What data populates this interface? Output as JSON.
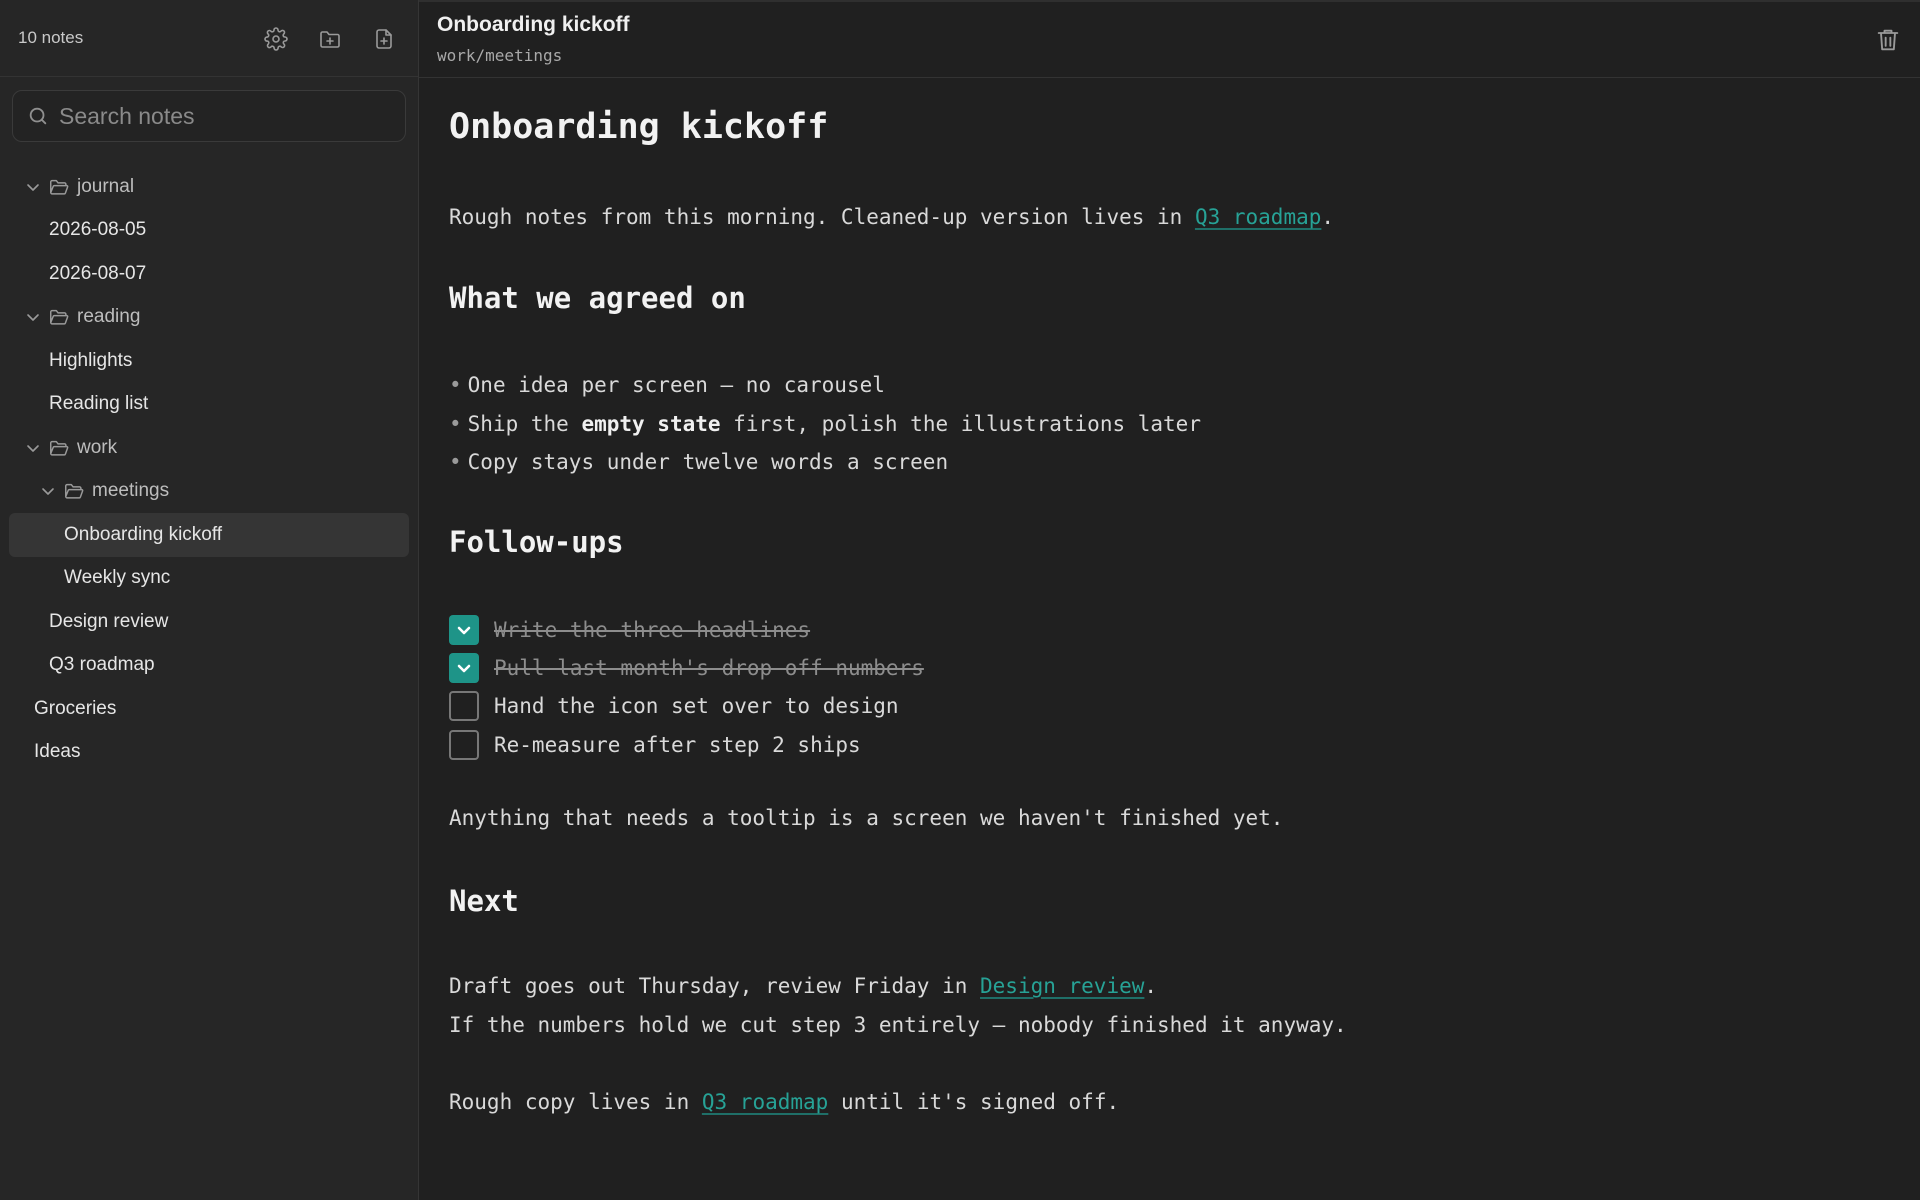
{
  "sidebar": {
    "note_count": "10 notes",
    "actions": [
      "settings",
      "new-folder",
      "new-note"
    ],
    "search": {
      "placeholder": "Search notes",
      "value": ""
    },
    "tree": [
      {
        "type": "folder",
        "label": "journal",
        "depth": 0,
        "expanded": true
      },
      {
        "type": "note",
        "label": "2026-08-05",
        "depth": 1
      },
      {
        "type": "note",
        "label": "2026-08-07",
        "depth": 1
      },
      {
        "type": "folder",
        "label": "reading",
        "depth": 0,
        "expanded": true
      },
      {
        "type": "note",
        "label": "Highlights",
        "depth": 1
      },
      {
        "type": "note",
        "label": "Reading list",
        "depth": 1
      },
      {
        "type": "folder",
        "label": "work",
        "depth": 0,
        "expanded": true
      },
      {
        "type": "folder",
        "label": "meetings",
        "depth": 1,
        "expanded": true
      },
      {
        "type": "note",
        "label": "Onboarding kickoff",
        "depth": 2,
        "active": true
      },
      {
        "type": "note",
        "label": "Weekly sync",
        "depth": 2
      },
      {
        "type": "note",
        "label": "Design review",
        "depth": 1
      },
      {
        "type": "note",
        "label": "Q3 roadmap",
        "depth": 1
      },
      {
        "type": "note",
        "label": "Groceries",
        "depth": 0
      },
      {
        "type": "note",
        "label": "Ideas",
        "depth": 0
      }
    ]
  },
  "note": {
    "title": "Onboarding kickoff",
    "path": "work/meetings",
    "heading": "Onboarding kickoff",
    "intro": {
      "before": "Rough notes from this morning. Cleaned-up version lives in ",
      "link": "Q3 roadmap",
      "after": "."
    },
    "section1": {
      "heading": "What we agreed on",
      "bullet1": "One idea per screen — no carousel",
      "bullet2_before": "Ship the ",
      "bullet2_bold": "empty state",
      "bullet2_after": " first, polish the illustrations later",
      "bullet3": "Copy stays under twelve words a screen"
    },
    "section2": {
      "heading": "Follow-ups",
      "tasks": [
        {
          "label": "Write the three headlines",
          "done": true
        },
        {
          "label": "Pull last month's drop-off numbers",
          "done": true
        },
        {
          "label": "Hand the icon set over to design",
          "done": false
        },
        {
          "label": "Re-measure after step 2 ships",
          "done": false
        }
      ],
      "quote": "Anything that needs a tooltip is a screen we haven't finished yet."
    },
    "section3": {
      "heading": "Next",
      "line1_before": "Draft goes out Thursday, review Friday in ",
      "line1_link": "Design review",
      "line1_after": ".",
      "line2": "If the numbers hold we cut step 3 entirely — nobody finished it anyway.",
      "line3_before": "Rough copy lives in ",
      "line3_link": "Q3 roadmap",
      "line3_after": " until it's signed off."
    }
  },
  "colors": {
    "accent": "#1e9488",
    "link": "#27a296",
    "background": "#202020",
    "sidebar": "#262626"
  }
}
